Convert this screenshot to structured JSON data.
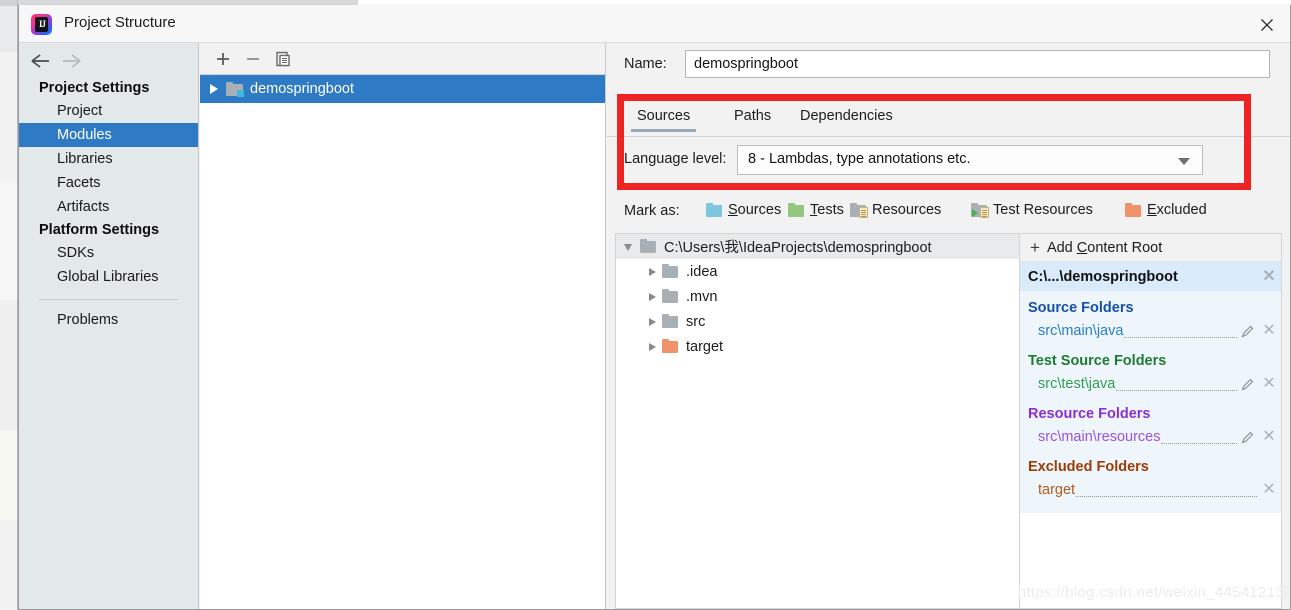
{
  "window": {
    "title": "Project Structure",
    "logo_icon": "intellij-idea-logo",
    "close_icon": "close-icon"
  },
  "nav": {
    "back_icon": "arrow-left-icon",
    "forward_icon": "arrow-right-icon"
  },
  "sidebar": {
    "groups": [
      {
        "heading": "Project Settings",
        "items": [
          {
            "label": "Project",
            "selected": false
          },
          {
            "label": "Modules",
            "selected": true
          },
          {
            "label": "Libraries",
            "selected": false
          },
          {
            "label": "Facets",
            "selected": false
          },
          {
            "label": "Artifacts",
            "selected": false
          }
        ]
      },
      {
        "heading": "Platform Settings",
        "items": [
          {
            "label": "SDKs",
            "selected": false
          },
          {
            "label": "Global Libraries",
            "selected": false
          }
        ]
      }
    ],
    "problems": "Problems",
    "selected_color": "#2f7ac4"
  },
  "modules_pane": {
    "toolbar": {
      "add_icon": "plus-icon",
      "remove_icon": "minus-icon",
      "copy_icon": "copy-icon"
    },
    "rows": [
      {
        "label": "demospringboot",
        "icon": "module-folder-icon",
        "selected": true,
        "expander": "collapsed"
      }
    ]
  },
  "detail": {
    "name_label": "Name:",
    "name_value": "demospringboot",
    "tabs": [
      {
        "label": "Sources",
        "active": true
      },
      {
        "label": "Paths",
        "active": false
      },
      {
        "label": "Dependencies",
        "active": false
      }
    ],
    "language_level_label": "Language level:",
    "language_level_value": "8 - Lambdas, type annotations etc.",
    "language_level_caret_icon": "chevron-down-icon",
    "mark_as_label": "Mark as:",
    "mark_as_options": [
      {
        "label": "Sources",
        "accel": "S",
        "color": "#7ec5e0",
        "kind": "plain"
      },
      {
        "label": "Tests",
        "accel": "T",
        "color": "#91c87e",
        "kind": "plain"
      },
      {
        "label": "Resources",
        "accel": "",
        "color": "#a9b0b5",
        "kind": "lines"
      },
      {
        "label": "Test Resources",
        "accel": "",
        "color": "#a9b0b5",
        "kind": "lines-play"
      },
      {
        "label": "Excluded",
        "accel": "E",
        "color": "#f0926a",
        "kind": "plain"
      }
    ]
  },
  "tree": {
    "rows": [
      {
        "label": "C:\\Users\\我\\IdeaProjects\\demospringboot",
        "indent": 0,
        "expander": "expanded",
        "icon": "folder-icon",
        "color": "gray",
        "selected": true
      },
      {
        "label": ".idea",
        "indent": 1,
        "expander": "collapsed",
        "icon": "folder-icon",
        "color": "gray",
        "selected": false
      },
      {
        "label": ".mvn",
        "indent": 1,
        "expander": "collapsed",
        "icon": "folder-icon",
        "color": "gray",
        "selected": false
      },
      {
        "label": "src",
        "indent": 1,
        "expander": "collapsed",
        "icon": "folder-icon",
        "color": "gray",
        "selected": false
      },
      {
        "label": "target",
        "indent": 1,
        "expander": "collapsed",
        "icon": "folder-icon",
        "color": "orange",
        "selected": false
      }
    ]
  },
  "content_root": {
    "add_label": "Add Content Root",
    "add_accel": "C",
    "add_icon": "plus-icon",
    "root_title": "C:\\...\\demospringboot",
    "root_remove_icon": "close-icon",
    "groups": [
      {
        "heading": "Source Folders",
        "color": "#1650a8",
        "entries": [
          {
            "path": "src\\main\\java",
            "color": "#2b7ec4",
            "has_edit": true,
            "edit_icon": "pencil-icon",
            "remove_icon": "close-icon"
          }
        ]
      },
      {
        "heading": "Test Source Folders",
        "color": "#1f7a33",
        "entries": [
          {
            "path": "src\\test\\java",
            "color": "#2f9e4f",
            "has_edit": true,
            "edit_icon": "pencil-icon",
            "remove_icon": "close-icon"
          }
        ]
      },
      {
        "heading": "Resource Folders",
        "color": "#8b2fd4",
        "entries": [
          {
            "path": "src\\main\\resources",
            "color": "#9b52dd",
            "has_edit": true,
            "edit_icon": "pencil-icon",
            "remove_icon": "close-icon"
          }
        ]
      },
      {
        "heading": "Excluded Folders",
        "color": "#9c3d05",
        "entries": [
          {
            "path": "target",
            "color": "#b05a22",
            "has_edit": false,
            "remove_icon": "close-icon"
          }
        ]
      }
    ]
  },
  "watermark": "https://blog.csdn.net/weixin_44541213"
}
